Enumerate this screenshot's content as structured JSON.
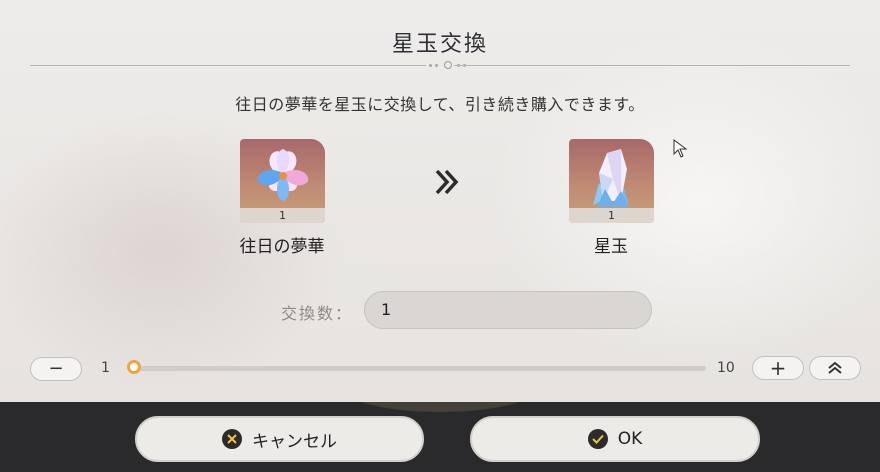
{
  "dialog": {
    "title": "星玉交換",
    "description": "往日の夢華を星玉に交換して、引き続き購入できます。"
  },
  "source_item": {
    "name": "往日の夢華",
    "count": "1",
    "icon": "dreamflower-icon"
  },
  "target_item": {
    "name": "星玉",
    "count": "1",
    "icon": "crystal-icon"
  },
  "quantity": {
    "label": "交換数：",
    "value": "1"
  },
  "slider": {
    "min": "1",
    "max": "10",
    "value": 1
  },
  "buttons": {
    "minus": "−",
    "plus": "+",
    "max": "max-icon",
    "cancel": "キャンセル",
    "ok": "OK"
  },
  "colors": {
    "accent": "#f2a33a",
    "footer": "#2a2a2c"
  }
}
